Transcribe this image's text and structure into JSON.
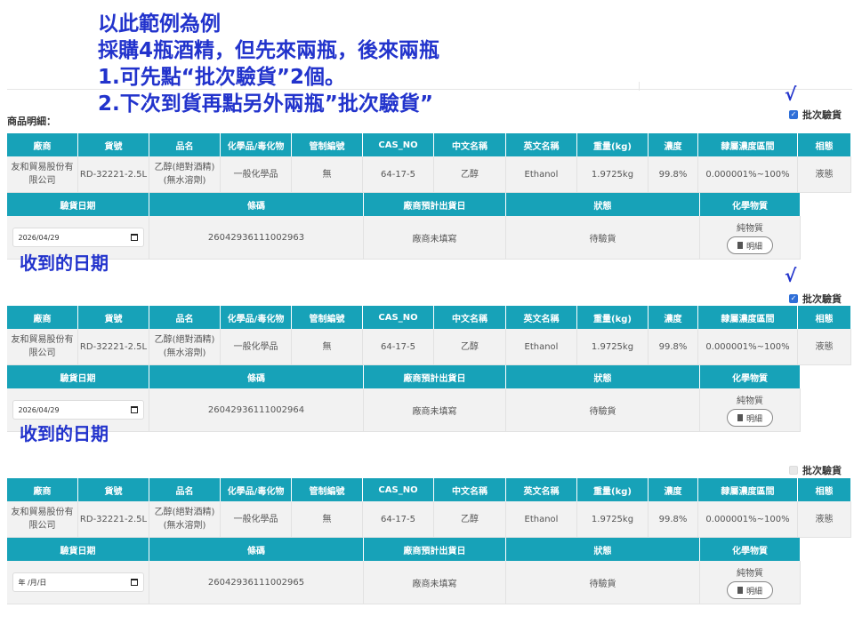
{
  "annotation": {
    "lines": [
      "以此範例為例",
      "採購4瓶酒精，但先來兩瓶，後來兩瓶",
      "1.可先點“批次驗貨”2個。",
      "2.下次到貨再點另外兩瓶”批次驗貨”"
    ],
    "received_date_note": "收到的日期",
    "check_mark": "√"
  },
  "section_label": "商品明細：",
  "batch_label": "批次驗貨",
  "columns": [
    "廠商",
    "貨號",
    "品名",
    "化學品/毒化物",
    "管制編號",
    "CAS_NO",
    "中文名稱",
    "英文名稱",
    "重量(kg)",
    "濃度",
    "隸屬濃度區間",
    "相態"
  ],
  "sub_columns": [
    "驗貨日期",
    "條碼",
    "廠商預計出貨日",
    "狀態",
    "化學物質"
  ],
  "detail_button_label": "明細",
  "items": [
    {
      "batch_checked": true,
      "row": [
        "友和貿易股份有限公司",
        "RD-32221-2.5L",
        "乙醇(絕對酒精)(無水溶劑)",
        "一般化學品",
        "無",
        "64-17-5",
        "乙醇",
        "Ethanol",
        "1.9725kg",
        "99.8%",
        "0.000001%~100%",
        "液態"
      ],
      "check_date": "2026/04/29",
      "barcode": "26042936111002963",
      "ship_date": "廠商未填寫",
      "status": "待驗貨",
      "chem_type": "純物質"
    },
    {
      "batch_checked": true,
      "row": [
        "友和貿易股份有限公司",
        "RD-32221-2.5L",
        "乙醇(絕對酒精)(無水溶劑)",
        "一般化學品",
        "無",
        "64-17-5",
        "乙醇",
        "Ethanol",
        "1.9725kg",
        "99.8%",
        "0.000001%~100%",
        "液態"
      ],
      "check_date": "2026/04/29",
      "barcode": "26042936111002964",
      "ship_date": "廠商未填寫",
      "status": "待驗貨",
      "chem_type": "純物質"
    },
    {
      "batch_checked": false,
      "row": [
        "友和貿易股份有限公司",
        "RD-32221-2.5L",
        "乙醇(絕對酒精)(無水溶劑)",
        "一般化學品",
        "無",
        "64-17-5",
        "乙醇",
        "Ethanol",
        "1.9725kg",
        "99.8%",
        "0.000001%~100%",
        "液態"
      ],
      "check_date": "年 /月/日",
      "barcode": "26042936111002965",
      "ship_date": "廠商未填寫",
      "status": "待驗貨",
      "chem_type": "純物質"
    }
  ]
}
